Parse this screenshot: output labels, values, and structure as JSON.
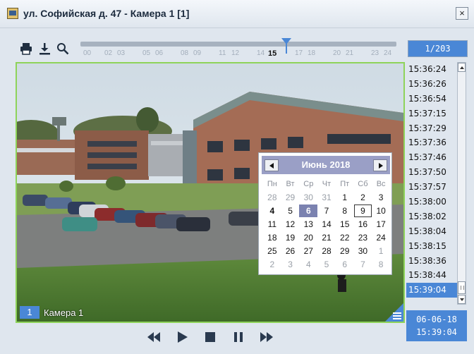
{
  "window": {
    "title": "ул. Софийская д. 47 - Камера 1 [1]",
    "close_label": "×"
  },
  "toolbar": {
    "icons": [
      "print-icon",
      "download-icon",
      "zoom-icon"
    ]
  },
  "timeline": {
    "labels": [
      "00",
      "02",
      "03",
      "05",
      "06",
      "08",
      "09",
      "11",
      "12",
      "14",
      "15",
      "17",
      "18",
      "20",
      "21",
      "23",
      "24"
    ],
    "current_label": "15",
    "marker_hour": 15.65
  },
  "video": {
    "camera_number": "1",
    "camera_name": "Камера 1"
  },
  "calendar": {
    "month_title": "Июнь 2018",
    "weekdays": [
      "Пн",
      "Вт",
      "Ср",
      "Чт",
      "Пт",
      "Сб",
      "Вс"
    ],
    "weeks": [
      [
        {
          "d": "28",
          "o": true
        },
        {
          "d": "29",
          "o": true
        },
        {
          "d": "30",
          "o": true
        },
        {
          "d": "31",
          "o": true
        },
        {
          "d": "1"
        },
        {
          "d": "2"
        },
        {
          "d": "3"
        }
      ],
      [
        {
          "d": "4",
          "today": true
        },
        {
          "d": "5"
        },
        {
          "d": "6",
          "selected": true
        },
        {
          "d": "7"
        },
        {
          "d": "8"
        },
        {
          "d": "9",
          "boxed": true
        },
        {
          "d": "10"
        }
      ],
      [
        {
          "d": "11"
        },
        {
          "d": "12"
        },
        {
          "d": "13"
        },
        {
          "d": "14"
        },
        {
          "d": "15"
        },
        {
          "d": "16"
        },
        {
          "d": "17"
        }
      ],
      [
        {
          "d": "18"
        },
        {
          "d": "19"
        },
        {
          "d": "20"
        },
        {
          "d": "21"
        },
        {
          "d": "22"
        },
        {
          "d": "23"
        },
        {
          "d": "24"
        }
      ],
      [
        {
          "d": "25"
        },
        {
          "d": "26"
        },
        {
          "d": "27"
        },
        {
          "d": "28"
        },
        {
          "d": "29"
        },
        {
          "d": "30"
        },
        {
          "d": "1",
          "o": true
        }
      ],
      [
        {
          "d": "2",
          "o": true
        },
        {
          "d": "3",
          "o": true
        },
        {
          "d": "4",
          "o": true
        },
        {
          "d": "5",
          "o": true
        },
        {
          "d": "6",
          "o": true
        },
        {
          "d": "7",
          "o": true
        },
        {
          "d": "8",
          "o": true
        }
      ]
    ]
  },
  "events": {
    "counter": "1/203",
    "items": [
      "15:36:24",
      "15:36:26",
      "15:36:54",
      "15:37:15",
      "15:37:29",
      "15:37:36",
      "15:37:46",
      "15:37:50",
      "15:37:57",
      "15:38:00",
      "15:38:02",
      "15:38:04",
      "15:38:15",
      "15:38:36",
      "15:38:44",
      "15:39:04"
    ],
    "active_index": 15
  },
  "datetime": {
    "date": "06-06-18",
    "time": "15:39:04"
  },
  "playback": {
    "buttons": [
      "rewind-icon",
      "play-icon",
      "stop-icon",
      "pause-icon",
      "fast-forward-icon"
    ]
  },
  "colors": {
    "accent": "#4a87d6",
    "frame_border": "#8ed35a",
    "calendar_header": "#9a9fc6"
  }
}
